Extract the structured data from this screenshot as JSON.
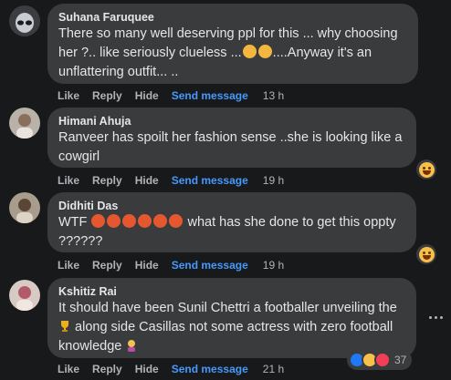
{
  "comments": [
    {
      "name": "Suhana Faruquee",
      "text": "There so many well deserving ppl for this ... why choosing her ?.. like seriously clueless ...",
      "text_tail": "....Anyway it's an unflattering outfit... ..",
      "emojis": [
        "pensive",
        "pensive"
      ],
      "time": "13 h"
    },
    {
      "name": "Himani Ahuja",
      "text": "Ranveer has spoilt her fashion sense ..she is looking like a cowgirl",
      "time": "19 h",
      "reaction": "haha"
    },
    {
      "name": "Didhiti Das",
      "text_head": "WTF",
      "text": "what has she done to get this oppty ??????",
      "emojis": [
        "angry",
        "angry",
        "angry",
        "angry",
        "angry",
        "angry"
      ],
      "time": "19 h",
      "reaction": "haha"
    },
    {
      "name": "Kshitiz Rai",
      "text_head": "It should have been Sunil Chettri a footballer unveiling the",
      "text": "along side Casillas not some actress with zero football knowledge",
      "emojis": [
        "trophy",
        "facepalm"
      ],
      "time": "21 h",
      "reactions": [
        "like",
        "haha",
        "love"
      ],
      "reaction_count": "37"
    }
  ],
  "actions": {
    "like": "Like",
    "reply": "Reply",
    "hide": "Hide",
    "send_message": "Send message"
  },
  "colors": {
    "background": "#18191a",
    "bubble": "#3a3b3c",
    "link": "#4599ff"
  }
}
